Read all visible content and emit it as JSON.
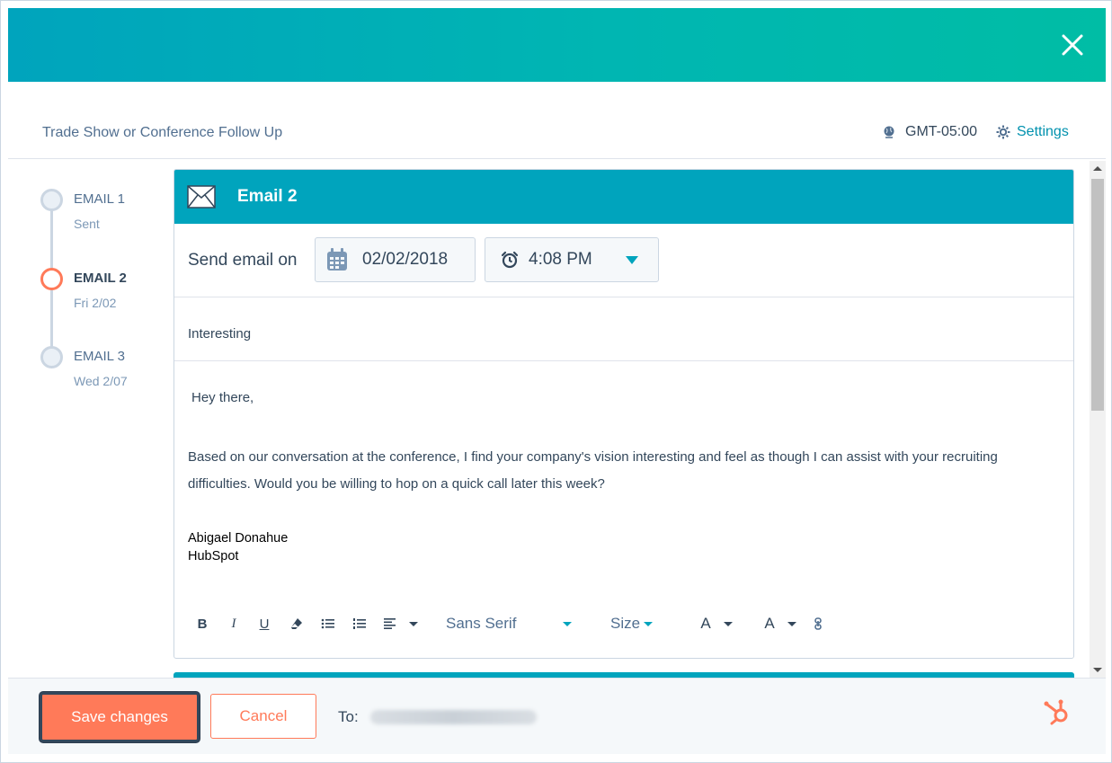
{
  "modal": {
    "close_label": "×"
  },
  "header": {
    "sequence_title": "Trade Show or Conference Follow Up",
    "timezone": "GMT-05:00",
    "settings_label": "Settings"
  },
  "timeline": {
    "items": [
      {
        "name": "EMAIL 1",
        "date": "Sent",
        "active": false
      },
      {
        "name": "EMAIL 2",
        "date": "Fri 2/02",
        "active": true
      },
      {
        "name": "EMAIL 3",
        "date": "Wed 2/07",
        "active": false
      }
    ]
  },
  "email": {
    "title": "Email 2",
    "send_label": "Send email on",
    "date": "02/02/2018",
    "time": "4:08 PM",
    "subject": "Interesting",
    "greeting": "Hey there,",
    "paragraph": "Based on our conversation at the conference, I find your company's vision interesting and feel as though I can assist with your recruiting difficulties. Would you be willing to hop on a quick call later this week?",
    "signature_name": "Abigael Donahue",
    "signature_company": "HubSpot"
  },
  "toolbar": {
    "bold": "B",
    "italic": "I",
    "underline": "U",
    "font": "Sans Serif",
    "size": "Size",
    "text_color": "A",
    "highlight": "A"
  },
  "footer": {
    "save_label": "Save changes",
    "cancel_label": "Cancel",
    "to_label": "To:"
  },
  "colors": {
    "accent": "#00a4bd",
    "primary_button": "#ff7a59",
    "text": "#33475b",
    "link": "#0091ae"
  },
  "icons": [
    "close-icon",
    "globe-icon",
    "gear-icon",
    "envelope-icon",
    "calendar-icon",
    "alarm-clock-icon",
    "chevron-down-icon",
    "hubspot-logo-icon"
  ]
}
